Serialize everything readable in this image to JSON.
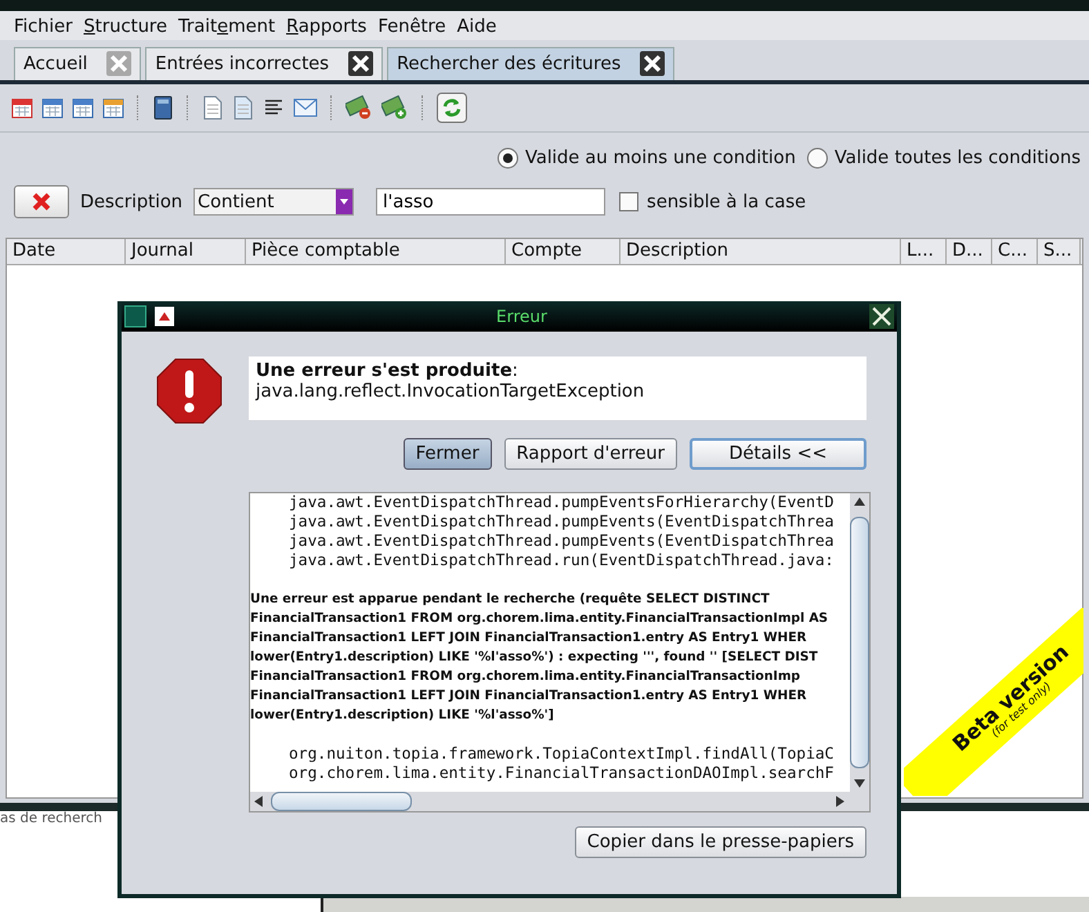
{
  "menu": [
    {
      "before": "Fichier"
    },
    {
      "key": "S",
      "after": "tructure"
    },
    {
      "before": "Trait",
      "key": "e",
      "after": "ment"
    },
    {
      "key": "R",
      "after": "apports"
    },
    {
      "before": "Fenêtre"
    },
    {
      "before": "Aide"
    }
  ],
  "tabs": [
    {
      "label": "Accueil",
      "selected": false,
      "close_enabled": false
    },
    {
      "label": "Entrées incorrectes",
      "selected": false,
      "close_enabled": true
    },
    {
      "label": "Rechercher des écritures",
      "selected": true,
      "close_enabled": true
    }
  ],
  "match_mode": [
    {
      "label": "Valide au moins une condition",
      "selected": true
    },
    {
      "label": "Valide toutes les conditions",
      "selected": false
    }
  ],
  "filter": {
    "field": "Description",
    "operator": "Contient",
    "value": "l'asso",
    "case_sensitive": {
      "label": "sensible à la case",
      "checked": false
    }
  },
  "table": {
    "columns": [
      "Date",
      "Journal",
      "Pièce comptable",
      "Compte",
      "Description",
      "L...",
      "D...",
      "C...",
      "S..."
    ]
  },
  "status_text": "as de recherch",
  "beta": {
    "title": "Beta version",
    "note": "(for test only)"
  },
  "dialog": {
    "title": "Erreur",
    "heading": "**Une erreur s'est produite**:",
    "exception": "java.lang.reflect.InvocationTargetException",
    "buttons": [
      {
        "label": "Fermer",
        "pressed": true,
        "focused": false
      },
      {
        "label": "Rapport d'erreur",
        "pressed": false,
        "focused": false
      },
      {
        "label": "Détails <<",
        "pressed": false,
        "focused": true
      }
    ],
    "details": [
      {
        "kind": "trace",
        "text": "java.awt.EventDispatchThread.pumpEventsForHierarchy(EventD"
      },
      {
        "kind": "trace",
        "text": "java.awt.EventDispatchThread.pumpEvents(EventDispatchThrea"
      },
      {
        "kind": "trace",
        "text": "java.awt.EventDispatchThread.pumpEvents(EventDispatchThrea"
      },
      {
        "kind": "trace",
        "text": "java.awt.EventDispatchThread.run(EventDispatchThread.java:"
      },
      {
        "kind": "blank"
      },
      {
        "kind": "message",
        "text": "Une erreur est apparue pendant le recherche (requête SELECT DISTINCT"
      },
      {
        "kind": "message",
        "text": "FinancialTransaction1 FROM org.chorem.lima.entity.FinancialTransactionImpl AS"
      },
      {
        "kind": "message",
        "text": "FinancialTransaction1 LEFT JOIN FinancialTransaction1.entry AS Entry1 WHER"
      },
      {
        "kind": "message",
        "text": "lower(Entry1.description) LIKE '%l'asso%') : expecting ''', found '' [SELECT DIST"
      },
      {
        "kind": "message",
        "text": "FinancialTransaction1 FROM org.chorem.lima.entity.FinancialTransactionImp"
      },
      {
        "kind": "message",
        "text": "FinancialTransaction1 LEFT JOIN FinancialTransaction1.entry AS Entry1 WHER"
      },
      {
        "kind": "message",
        "text": "lower(Entry1.description) LIKE '%l'asso%']"
      },
      {
        "kind": "blank"
      },
      {
        "kind": "trace",
        "text": "org.nuiton.topia.framework.TopiaContextImpl.findAll(TopiaC"
      },
      {
        "kind": "trace",
        "text": "org.chorem.lima.entity.FinancialTransactionDAOImpl.searchF"
      }
    ],
    "copy_button": "Copier dans le presse-papiers"
  }
}
